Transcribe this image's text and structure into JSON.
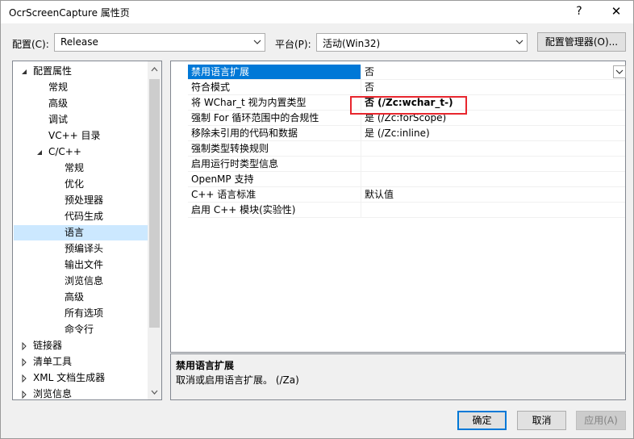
{
  "window": {
    "title": "OcrScreenCapture 属性页",
    "help": "?",
    "close": "✕"
  },
  "toolbar": {
    "config_label": "配置(C):",
    "config_value": "Release",
    "platform_label": "平台(P):",
    "platform_value": "活动(Win32)",
    "config_manager_label": "配置管理器(O)..."
  },
  "tree": {
    "items": [
      {
        "label": "配置属性",
        "expander": "expanded"
      },
      {
        "label": "常规"
      },
      {
        "label": "高级"
      },
      {
        "label": "调试"
      },
      {
        "label": "VC++ 目录"
      },
      {
        "label": "C/C++",
        "expander": "expanded"
      },
      {
        "label": "常规"
      },
      {
        "label": "优化"
      },
      {
        "label": "预处理器"
      },
      {
        "label": "代码生成"
      },
      {
        "label": "语言",
        "selected": true
      },
      {
        "label": "预编译头"
      },
      {
        "label": "输出文件"
      },
      {
        "label": "浏览信息"
      },
      {
        "label": "高级"
      },
      {
        "label": "所有选项"
      },
      {
        "label": "命令行"
      },
      {
        "label": "链接器",
        "expander": "collapsed"
      },
      {
        "label": "清单工具",
        "expander": "collapsed"
      },
      {
        "label": "XML 文档生成器",
        "expander": "collapsed"
      },
      {
        "label": "浏览信息",
        "expander": "collapsed"
      }
    ]
  },
  "grid": {
    "rows": [
      {
        "name": "禁用语言扩展",
        "value": "否",
        "selected": true
      },
      {
        "name": "符合模式",
        "value": "否"
      },
      {
        "name": "将 WChar_t 视为内置类型",
        "value": "否 (/Zc:wchar_t-)",
        "bold": true
      },
      {
        "name": "强制 For 循环范围中的合规性",
        "value": "是 (/Zc:forScope)"
      },
      {
        "name": "移除未引用的代码和数据",
        "value": "是 (/Zc:inline)"
      },
      {
        "name": "强制类型转换规则",
        "value": ""
      },
      {
        "name": "启用运行时类型信息",
        "value": ""
      },
      {
        "name": "OpenMP 支持",
        "value": ""
      },
      {
        "name": "C++ 语言标准",
        "value": "默认值"
      },
      {
        "name": "启用 C++ 模块(实验性)",
        "value": ""
      }
    ]
  },
  "description": {
    "title": "禁用语言扩展",
    "text": "取消或启用语言扩展。     (/Za)"
  },
  "buttons": {
    "ok": "确定",
    "cancel": "取消",
    "apply": "应用(A)"
  },
  "colors": {
    "selection": "#0078d7",
    "tree_selection": "#cce8ff",
    "highlight": "#e8262e"
  }
}
